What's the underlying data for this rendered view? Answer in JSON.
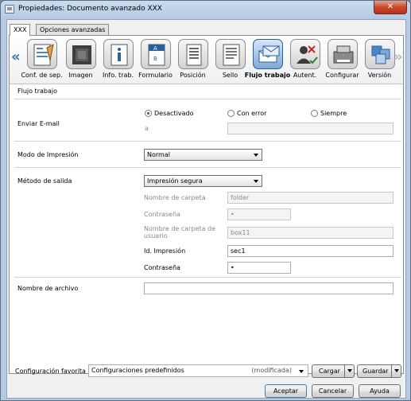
{
  "window": {
    "title": "Propiedades: Documento avanzado XXX",
    "close_label": "✕"
  },
  "tabs": [
    {
      "label": "XXX",
      "active": true
    },
    {
      "label": "Opciones avanzadas",
      "active": false
    }
  ],
  "icon_strip": {
    "left_arrow": "«",
    "right_arrow": "»",
    "items": [
      {
        "label": "Conf. de sep.",
        "icon": "copy-settings-icon"
      },
      {
        "label": "Imagen",
        "icon": "image-quality-icon"
      },
      {
        "label": "Info. trab.",
        "icon": "job-info-icon"
      },
      {
        "label": "Formulario",
        "icon": "form-overlay-icon"
      },
      {
        "label": "Posición",
        "icon": "page-layout-icon"
      },
      {
        "label": "Sello",
        "icon": "stamp-icon"
      },
      {
        "label": "Flujo trabajo",
        "icon": "workflow-icon",
        "selected": true
      },
      {
        "label": "Autent.",
        "icon": "authentication-icon"
      },
      {
        "label": "Configurar",
        "icon": "printer-setup-icon"
      },
      {
        "label": "Versión",
        "icon": "version-icon"
      }
    ]
  },
  "section": {
    "title": "Flujo trabajo"
  },
  "email": {
    "label": "Enviar E-mail",
    "options": [
      "Desactivado",
      "Con error",
      "Siempre"
    ],
    "selected": "Desactivado",
    "to_label": "a",
    "to_value": ""
  },
  "print_mode": {
    "label": "Modo de Impresión",
    "value": "Normal"
  },
  "output": {
    "label": "Método de salida",
    "value": "Impresión segura",
    "folder_label": "Nombre de carpeta",
    "folder_value": "folder",
    "password_label": "Contraseña",
    "password_value": "•",
    "user_folder_label": "Nombre de carpeta de usuario",
    "user_folder_value": "box11",
    "print_id_label": "Id. Impresión",
    "print_id_value": "sec1",
    "print_password_label": "Contraseña",
    "print_password_value": "•"
  },
  "file_name": {
    "label": "Nombre de archivo",
    "value": ""
  },
  "favorites": {
    "label": "Configuración favorita",
    "value": "Configuraciones predefinidos",
    "modified": "(modificada)",
    "load_label": "Cargar",
    "save_label": "Guardar"
  },
  "footer": {
    "accept_label": "Aceptar",
    "cancel_label": "Cancelar",
    "help_label": "Ayuda"
  }
}
